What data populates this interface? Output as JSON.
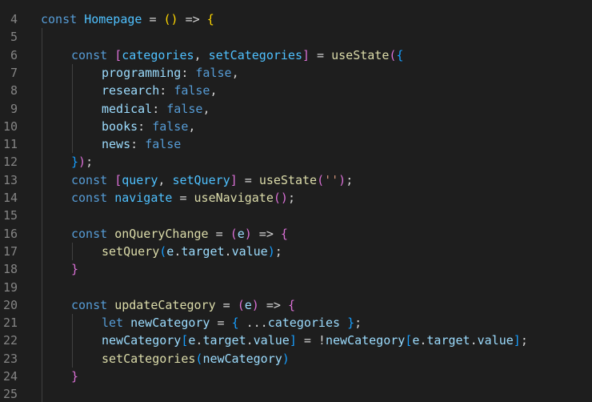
{
  "editor": {
    "lines": [
      {
        "num": "4",
        "indent": 0,
        "tokens": [
          [
            "kw",
            "const "
          ],
          [
            "const",
            "Homepage"
          ],
          [
            "op",
            " = "
          ],
          [
            "br1",
            "()"
          ],
          [
            "op",
            " => "
          ],
          [
            "br1",
            "{"
          ]
        ]
      },
      {
        "num": "5",
        "indent": 0,
        "tokens": []
      },
      {
        "num": "6",
        "indent": 1,
        "tokens": [
          [
            "kw",
            "const "
          ],
          [
            "br2",
            "["
          ],
          [
            "const",
            "categories"
          ],
          [
            "op",
            ", "
          ],
          [
            "const",
            "setCategories"
          ],
          [
            "br2",
            "]"
          ],
          [
            "op",
            " = "
          ],
          [
            "fn",
            "useState"
          ],
          [
            "br2",
            "("
          ],
          [
            "br3",
            "{"
          ]
        ]
      },
      {
        "num": "7",
        "indent": 2,
        "tokens": [
          [
            "var",
            "programming"
          ],
          [
            "op",
            ": "
          ],
          [
            "bool",
            "false"
          ],
          [
            "op",
            ","
          ]
        ]
      },
      {
        "num": "8",
        "indent": 2,
        "tokens": [
          [
            "var",
            "research"
          ],
          [
            "op",
            ": "
          ],
          [
            "bool",
            "false"
          ],
          [
            "op",
            ","
          ]
        ]
      },
      {
        "num": "9",
        "indent": 2,
        "tokens": [
          [
            "var",
            "medical"
          ],
          [
            "op",
            ": "
          ],
          [
            "bool",
            "false"
          ],
          [
            "op",
            ","
          ]
        ]
      },
      {
        "num": "10",
        "indent": 2,
        "tokens": [
          [
            "var",
            "books"
          ],
          [
            "op",
            ": "
          ],
          [
            "bool",
            "false"
          ],
          [
            "op",
            ","
          ]
        ]
      },
      {
        "num": "11",
        "indent": 2,
        "tokens": [
          [
            "var",
            "news"
          ],
          [
            "op",
            ": "
          ],
          [
            "bool",
            "false"
          ]
        ]
      },
      {
        "num": "12",
        "indent": 1,
        "tokens": [
          [
            "br3",
            "}"
          ],
          [
            "br2",
            ")"
          ],
          [
            "op",
            ";"
          ]
        ]
      },
      {
        "num": "13",
        "indent": 1,
        "tokens": [
          [
            "kw",
            "const "
          ],
          [
            "br2",
            "["
          ],
          [
            "const",
            "query"
          ],
          [
            "op",
            ", "
          ],
          [
            "const",
            "setQuery"
          ],
          [
            "br2",
            "]"
          ],
          [
            "op",
            " = "
          ],
          [
            "fn",
            "useState"
          ],
          [
            "br2",
            "("
          ],
          [
            "str",
            "''"
          ],
          [
            "br2",
            ")"
          ],
          [
            "op",
            ";"
          ]
        ]
      },
      {
        "num": "14",
        "indent": 1,
        "tokens": [
          [
            "kw",
            "const "
          ],
          [
            "const",
            "navigate"
          ],
          [
            "op",
            " = "
          ],
          [
            "fn",
            "useNavigate"
          ],
          [
            "br2",
            "()"
          ],
          [
            "op",
            ";"
          ]
        ]
      },
      {
        "num": "15",
        "indent": 0,
        "tokens": []
      },
      {
        "num": "16",
        "indent": 1,
        "tokens": [
          [
            "kw",
            "const "
          ],
          [
            "fn",
            "onQueryChange"
          ],
          [
            "op",
            " = "
          ],
          [
            "br2",
            "("
          ],
          [
            "var",
            "e"
          ],
          [
            "br2",
            ")"
          ],
          [
            "op",
            " => "
          ],
          [
            "br2",
            "{"
          ]
        ]
      },
      {
        "num": "17",
        "indent": 2,
        "tokens": [
          [
            "fn",
            "setQuery"
          ],
          [
            "br3",
            "("
          ],
          [
            "var",
            "e"
          ],
          [
            "op",
            "."
          ],
          [
            "var",
            "target"
          ],
          [
            "op",
            "."
          ],
          [
            "var",
            "value"
          ],
          [
            "br3",
            ")"
          ],
          [
            "op",
            ";"
          ]
        ]
      },
      {
        "num": "18",
        "indent": 1,
        "tokens": [
          [
            "br2",
            "}"
          ]
        ]
      },
      {
        "num": "19",
        "indent": 0,
        "tokens": []
      },
      {
        "num": "20",
        "indent": 1,
        "tokens": [
          [
            "kw",
            "const "
          ],
          [
            "fn",
            "updateCategory"
          ],
          [
            "op",
            " = "
          ],
          [
            "br2",
            "("
          ],
          [
            "var",
            "e"
          ],
          [
            "br2",
            ")"
          ],
          [
            "op",
            " => "
          ],
          [
            "br2",
            "{"
          ]
        ]
      },
      {
        "num": "21",
        "indent": 2,
        "tokens": [
          [
            "kw",
            "let "
          ],
          [
            "var",
            "newCategory"
          ],
          [
            "op",
            " = "
          ],
          [
            "br3",
            "{"
          ],
          [
            "op",
            " ..."
          ],
          [
            "var",
            "categories"
          ],
          [
            "op",
            " "
          ],
          [
            "br3",
            "}"
          ],
          [
            "op",
            ";"
          ]
        ]
      },
      {
        "num": "22",
        "indent": 2,
        "tokens": [
          [
            "var",
            "newCategory"
          ],
          [
            "br3",
            "["
          ],
          [
            "var",
            "e"
          ],
          [
            "op",
            "."
          ],
          [
            "var",
            "target"
          ],
          [
            "op",
            "."
          ],
          [
            "var",
            "value"
          ],
          [
            "br3",
            "]"
          ],
          [
            "op",
            " = !"
          ],
          [
            "var",
            "newCategory"
          ],
          [
            "br3",
            "["
          ],
          [
            "var",
            "e"
          ],
          [
            "op",
            "."
          ],
          [
            "var",
            "target"
          ],
          [
            "op",
            "."
          ],
          [
            "var",
            "value"
          ],
          [
            "br3",
            "]"
          ],
          [
            "op",
            ";"
          ]
        ]
      },
      {
        "num": "23",
        "indent": 2,
        "tokens": [
          [
            "fn",
            "setCategories"
          ],
          [
            "br3",
            "("
          ],
          [
            "var",
            "newCategory"
          ],
          [
            "br3",
            ")"
          ]
        ]
      },
      {
        "num": "24",
        "indent": 1,
        "tokens": [
          [
            "br2",
            "}"
          ]
        ]
      },
      {
        "num": "25",
        "indent": 0,
        "tokens": []
      }
    ]
  }
}
